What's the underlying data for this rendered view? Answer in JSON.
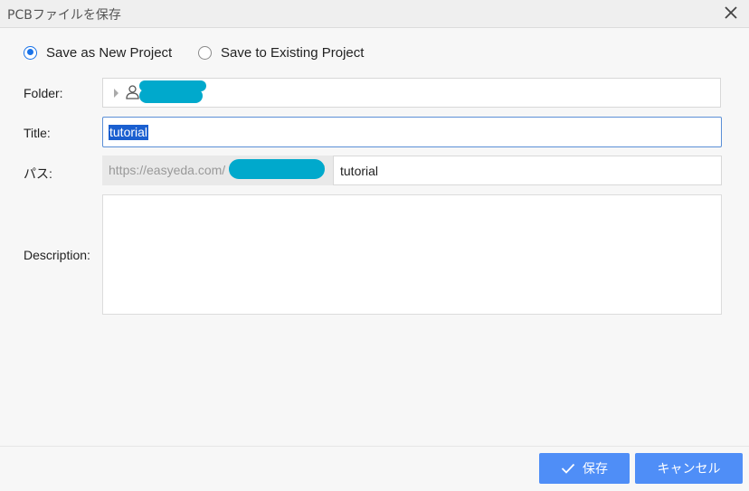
{
  "dialog": {
    "title": "PCBファイルを保存"
  },
  "save_mode": {
    "options": [
      {
        "label": "Save as New Project",
        "selected": true
      },
      {
        "label": "Save to Existing Project",
        "selected": false
      }
    ]
  },
  "form": {
    "folder_label": "Folder:",
    "title_label": "Title:",
    "title_value": "tutorial",
    "path_label": "パス:",
    "path_prefix": "https://easyeda.com/",
    "path_slash": "/",
    "path_value": "tutorial",
    "description_label": "Description:",
    "description_value": ""
  },
  "buttons": {
    "save_label": "保存",
    "cancel_label": "キャンセル"
  },
  "colors": {
    "accent": "#4f8ef7",
    "radio_selected": "#1a73e8",
    "redaction": "#00a9cc",
    "selection": "#1a5fd0"
  },
  "icons": {
    "close": "close-icon",
    "expand": "caret-right-icon",
    "user": "user-icon",
    "check": "check-icon"
  }
}
